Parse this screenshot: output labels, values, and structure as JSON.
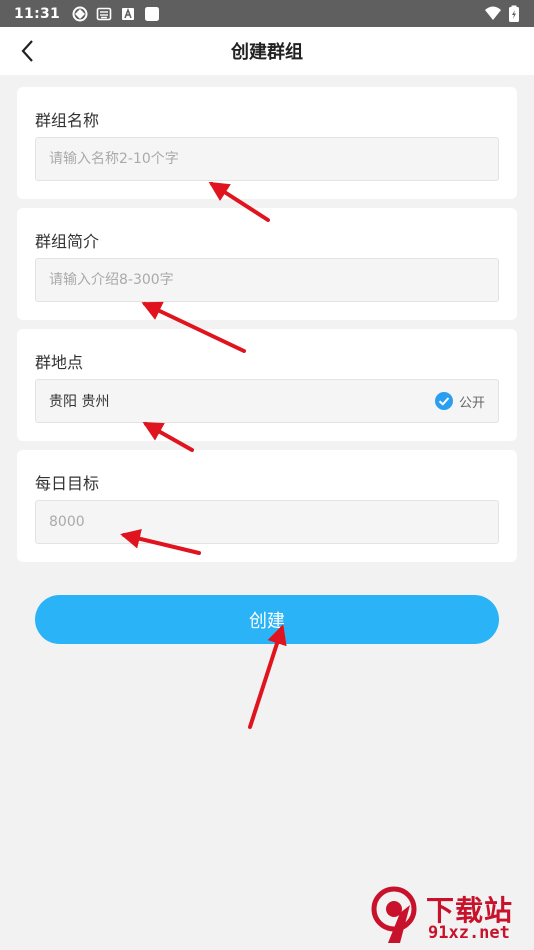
{
  "status_bar": {
    "time": "11:31"
  },
  "header": {
    "title": "创建群组"
  },
  "form": {
    "group_name": {
      "label": "群组名称",
      "placeholder": "请输入名称2-10个字"
    },
    "group_intro": {
      "label": "群组简介",
      "placeholder": "请输入介绍8-300字"
    },
    "group_location": {
      "label": "群地点",
      "value": "贵阳 贵州",
      "public_label": "公开",
      "public_checked": true
    },
    "daily_goal": {
      "label": "每日目标",
      "placeholder": "8000"
    }
  },
  "actions": {
    "create_label": "创建"
  },
  "watermark": {
    "brand": "下载站",
    "site": "91xz.net"
  },
  "colors": {
    "accent": "#2ab4f7",
    "check": "#2a9ff2",
    "annotation_arrow": "#e0141e",
    "watermark": "#c8122c"
  }
}
